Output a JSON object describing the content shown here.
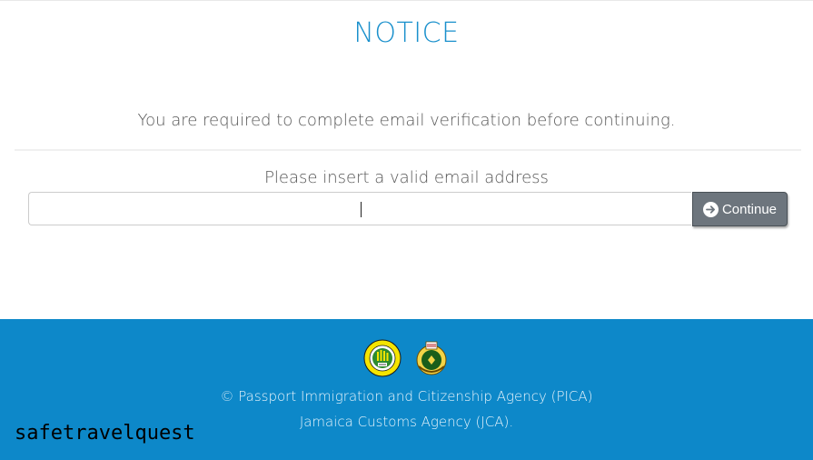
{
  "notice": {
    "title": "NOTICE",
    "message": "You are required to complete email verification before continuing."
  },
  "form": {
    "label": "Please insert a valid email address",
    "email_value": "",
    "continue_label": "Continue",
    "continue_icon": "arrow-right-circle-icon"
  },
  "footer": {
    "logos": [
      "pica-logo",
      "jca-logo"
    ],
    "line1": "© Passport Immigration and Citizenship Agency (PICA)",
    "line2": "Jamaica Customs Agency (JCA)."
  },
  "watermark": {
    "text": "safetravelquest"
  },
  "colors": {
    "title": "#1a90cc",
    "footer_bg": "#0d88c9",
    "button_bg": "#6d757d"
  }
}
